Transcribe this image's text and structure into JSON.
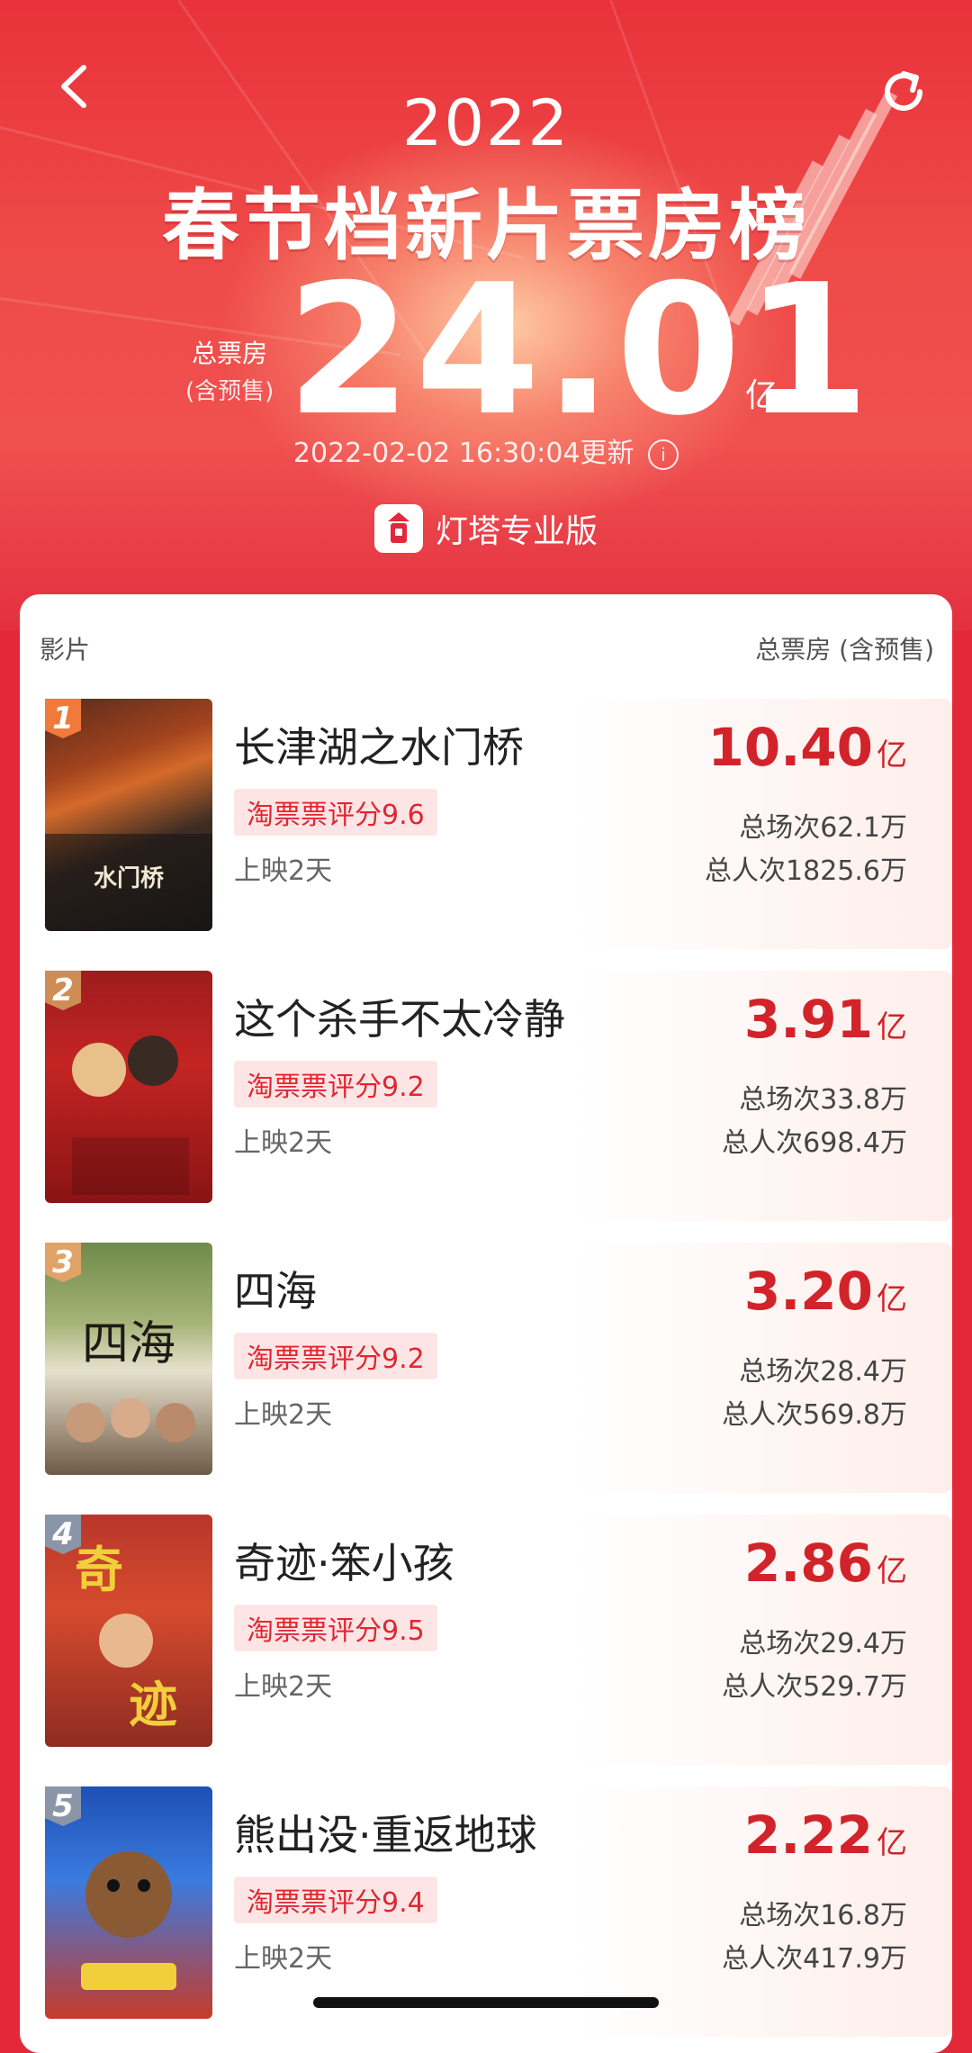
{
  "nav": {
    "back_icon": "chevron-left-icon",
    "refresh_icon": "refresh-icon"
  },
  "hero": {
    "year": "2022",
    "title": "春节档新片票房榜",
    "total_label": "总票房",
    "total_sub": "(含预售)",
    "total_value": "24.01",
    "total_unit": "亿",
    "updated": "2022-02-02 16:30:04更新",
    "info_icon": "info-icon",
    "brand": "灯塔专业版"
  },
  "table": {
    "col_film": "影片",
    "col_gross": "总票房 (含预售)",
    "rows": [
      {
        "rank": "1",
        "title": "长津湖之水门桥",
        "rating": "淘票票评分9.6",
        "days": "上映2天",
        "gross": "10.40",
        "unit": "亿",
        "shows": "总场次62.1万",
        "people": "总人次1825.6万"
      },
      {
        "rank": "2",
        "title": "这个杀手不太冷静",
        "rating": "淘票票评分9.2",
        "days": "上映2天",
        "gross": "3.91",
        "unit": "亿",
        "shows": "总场次33.8万",
        "people": "总人次698.4万"
      },
      {
        "rank": "3",
        "title": "四海",
        "rating": "淘票票评分9.2",
        "days": "上映2天",
        "gross": "3.20",
        "unit": "亿",
        "shows": "总场次28.4万",
        "people": "总人次569.8万"
      },
      {
        "rank": "4",
        "title": "奇迹·笨小孩",
        "rating": "淘票票评分9.5",
        "days": "上映2天",
        "gross": "2.86",
        "unit": "亿",
        "shows": "总场次29.4万",
        "people": "总人次529.7万"
      },
      {
        "rank": "5",
        "title": "熊出没·重返地球",
        "rating": "淘票票评分9.4",
        "days": "上映2天",
        "gross": "2.22",
        "unit": "亿",
        "shows": "总场次16.8万",
        "people": "总人次417.9万"
      }
    ]
  },
  "colors": {
    "accent": "#e3283a",
    "gross": "#d2232a",
    "rating_bg": "#fde5e6"
  }
}
